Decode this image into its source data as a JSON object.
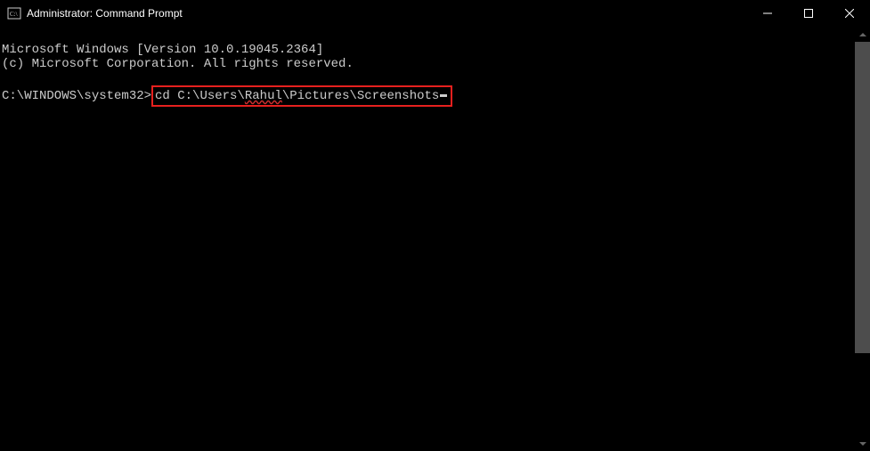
{
  "window": {
    "title": "Administrator: Command Prompt"
  },
  "terminal": {
    "line1": "Microsoft Windows [Version 10.0.19045.2364]",
    "line2": "(c) Microsoft Corporation. All rights reserved.",
    "prompt": "C:\\WINDOWS\\system32>",
    "command_pre": "cd C:\\Users\\",
    "command_user": "Rahul",
    "command_post": "\\Pictures\\Screenshots"
  }
}
